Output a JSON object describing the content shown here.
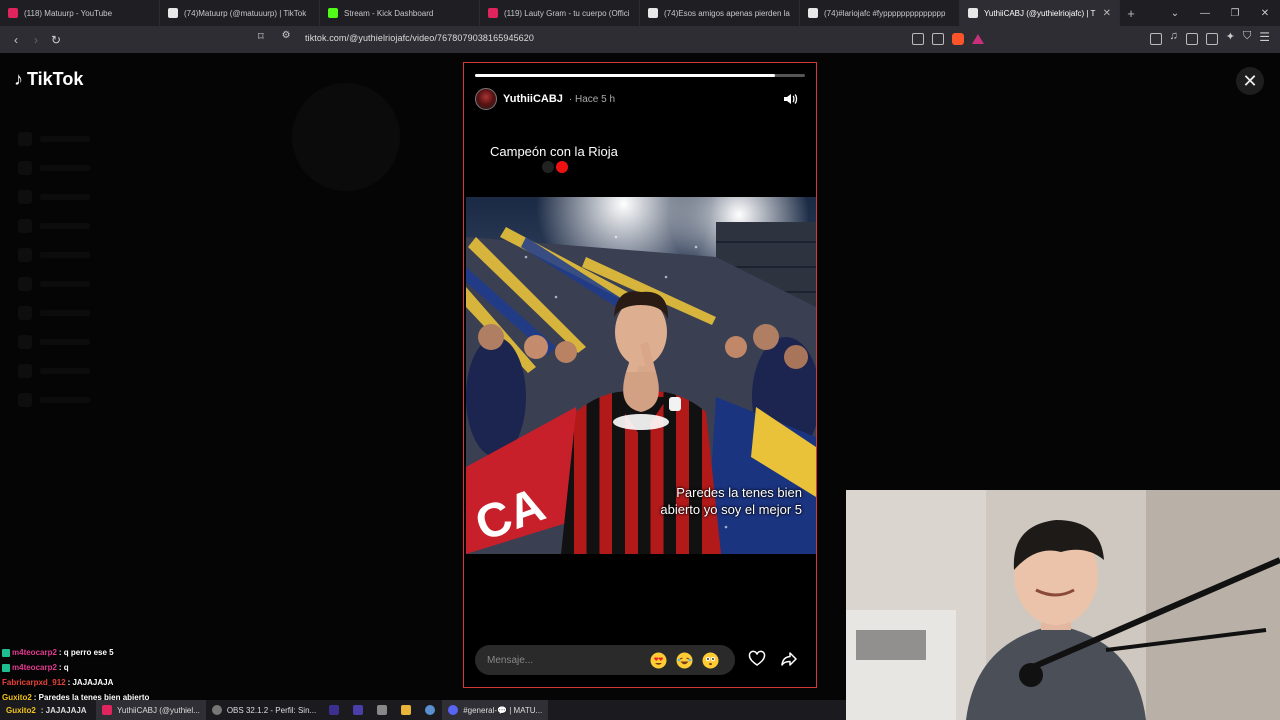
{
  "browser": {
    "tabs": [
      {
        "title": "(118) Matuurp - YouTube",
        "favicon_color": "#e0245e"
      },
      {
        "title": "(74)Matuurp (@matuuurp) | TikTok",
        "favicon_color": "#e8e8e8"
      },
      {
        "title": "Stream - Kick Dashboard",
        "favicon_color": "#53fc18"
      },
      {
        "title": "(119) Lauty Gram - tu cuerpo (Offici",
        "favicon_color": "#e0245e"
      },
      {
        "title": "(74)Esos amigos apenas pierden la",
        "favicon_color": "#e8e8e8"
      },
      {
        "title": "(74)#lariojafc #fypppppppppppppp",
        "favicon_color": "#e8e8e8"
      },
      {
        "title": "YuthiiCABJ (@yuthielriojafc) | T",
        "favicon_color": "#e8e8e8",
        "active": true
      }
    ],
    "url": "tiktok.com/@yuthielriojafc/video/7678079038165945620"
  },
  "tiktok": {
    "logo": "TikTok",
    "close_glyph": "✕"
  },
  "story": {
    "progress": 0.91,
    "username": "YuthiiCABJ",
    "time": "· Hace 5 h",
    "caption": "Campeón con la Rioja",
    "overlay_line1": "Paredes la tenes bien",
    "overlay_line2": "abierto yo soy el mejor 5",
    "message_placeholder": "Mensaje...",
    "emojis": [
      "heart-eyes",
      "laughing",
      "flushed"
    ]
  },
  "chat": [
    {
      "user": "m4teocarp2",
      "user_color": "#e23a8f",
      "text": ": q perro ese 5",
      "badge": true
    },
    {
      "user": "m4teocarp2",
      "user_color": "#e23a8f",
      "text": ": q",
      "badge": true
    },
    {
      "user": "Fabricarpxd_912",
      "user_color": "#e8423a",
      "text": ": JAJAJAJA",
      "badge": false
    },
    {
      "user": "Guxito2",
      "user_color": "#f0c419",
      "text": ": Paredes la tenes bien abierto",
      "badge": false
    },
    {
      "user": "Guxito2",
      "user_color": "#f0c419",
      "text": ": JAJAJAJA",
      "badge": false
    }
  ],
  "taskbar": {
    "items": [
      {
        "label": "YuthiiCABJ (@yuthiel...",
        "color": "#e0245e",
        "active": true
      },
      {
        "label": "OBS 32.1.2 - Perfil: Sin...",
        "color": "#777777",
        "active": false
      },
      {
        "label": "#general-💬 | MATU...",
        "color": "#5865f2",
        "active": true
      }
    ]
  }
}
